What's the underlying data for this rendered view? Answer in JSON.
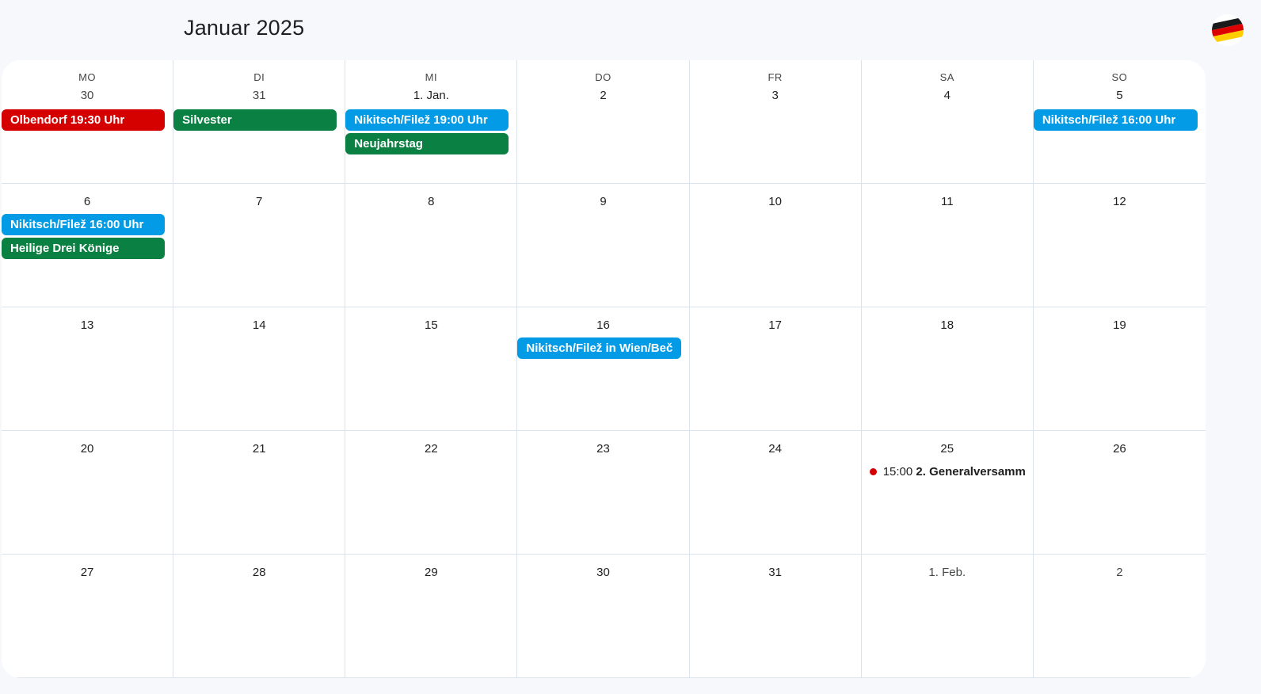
{
  "header": {
    "month_title": "Januar 2025"
  },
  "colors": {
    "red": "#d50000",
    "green": "#0b8043",
    "blue": "#039be5",
    "dot_red": "#d50000"
  },
  "weekdays": [
    "MO",
    "DI",
    "MI",
    "DO",
    "FR",
    "SA",
    "SO"
  ],
  "weeks": [
    {
      "days": [
        {
          "label": "30",
          "other": true,
          "events": [
            {
              "type": "chip",
              "title": "Olbendorf 19:30 Uhr",
              "color": "#d50000"
            }
          ]
        },
        {
          "label": "31",
          "other": true,
          "events": [
            {
              "type": "chip",
              "title": "Silvester",
              "color": "#0b8043"
            }
          ]
        },
        {
          "label": "1. Jan.",
          "other": false,
          "events": [
            {
              "type": "chip",
              "title": "Nikitsch/Filež 19:00 Uhr",
              "color": "#039be5"
            },
            {
              "type": "chip",
              "title": "Neujahrstag",
              "color": "#0b8043"
            }
          ]
        },
        {
          "label": "2",
          "other": false,
          "events": []
        },
        {
          "label": "3",
          "other": false,
          "events": []
        },
        {
          "label": "4",
          "other": false,
          "events": []
        },
        {
          "label": "5",
          "other": false,
          "events": [
            {
              "type": "chip",
              "title": "Nikitsch/Filež 16:00 Uhr",
              "color": "#039be5"
            }
          ]
        }
      ]
    },
    {
      "days": [
        {
          "label": "6",
          "other": false,
          "events": [
            {
              "type": "chip",
              "title": "Nikitsch/Filež 16:00 Uhr",
              "color": "#039be5"
            },
            {
              "type": "chip",
              "title": "Heilige Drei Könige",
              "color": "#0b8043"
            }
          ]
        },
        {
          "label": "7",
          "other": false,
          "events": []
        },
        {
          "label": "8",
          "other": false,
          "events": []
        },
        {
          "label": "9",
          "other": false,
          "events": []
        },
        {
          "label": "10",
          "other": false,
          "events": []
        },
        {
          "label": "11",
          "other": false,
          "events": []
        },
        {
          "label": "12",
          "other": false,
          "events": []
        }
      ]
    },
    {
      "days": [
        {
          "label": "13",
          "other": false,
          "events": []
        },
        {
          "label": "14",
          "other": false,
          "events": []
        },
        {
          "label": "15",
          "other": false,
          "events": []
        },
        {
          "label": "16",
          "other": false,
          "events": [
            {
              "type": "chip",
              "title": "Nikitsch/Filež in Wien/Beč",
              "color": "#039be5"
            }
          ]
        },
        {
          "label": "17",
          "other": false,
          "events": []
        },
        {
          "label": "18",
          "other": false,
          "events": []
        },
        {
          "label": "19",
          "other": false,
          "events": []
        }
      ]
    },
    {
      "days": [
        {
          "label": "20",
          "other": false,
          "events": []
        },
        {
          "label": "21",
          "other": false,
          "events": []
        },
        {
          "label": "22",
          "other": false,
          "events": []
        },
        {
          "label": "23",
          "other": false,
          "events": []
        },
        {
          "label": "24",
          "other": false,
          "events": []
        },
        {
          "label": "25",
          "other": false,
          "events": [
            {
              "type": "dot",
              "time": "15:00",
              "title": "2. Generalversamm",
              "color": "#d50000"
            }
          ]
        },
        {
          "label": "26",
          "other": false,
          "events": []
        }
      ]
    },
    {
      "days": [
        {
          "label": "27",
          "other": false,
          "events": []
        },
        {
          "label": "28",
          "other": false,
          "events": []
        },
        {
          "label": "29",
          "other": false,
          "events": []
        },
        {
          "label": "30",
          "other": false,
          "events": []
        },
        {
          "label": "31",
          "other": false,
          "events": []
        },
        {
          "label": "1. Feb.",
          "other": true,
          "events": []
        },
        {
          "label": "2",
          "other": true,
          "events": []
        }
      ]
    }
  ]
}
